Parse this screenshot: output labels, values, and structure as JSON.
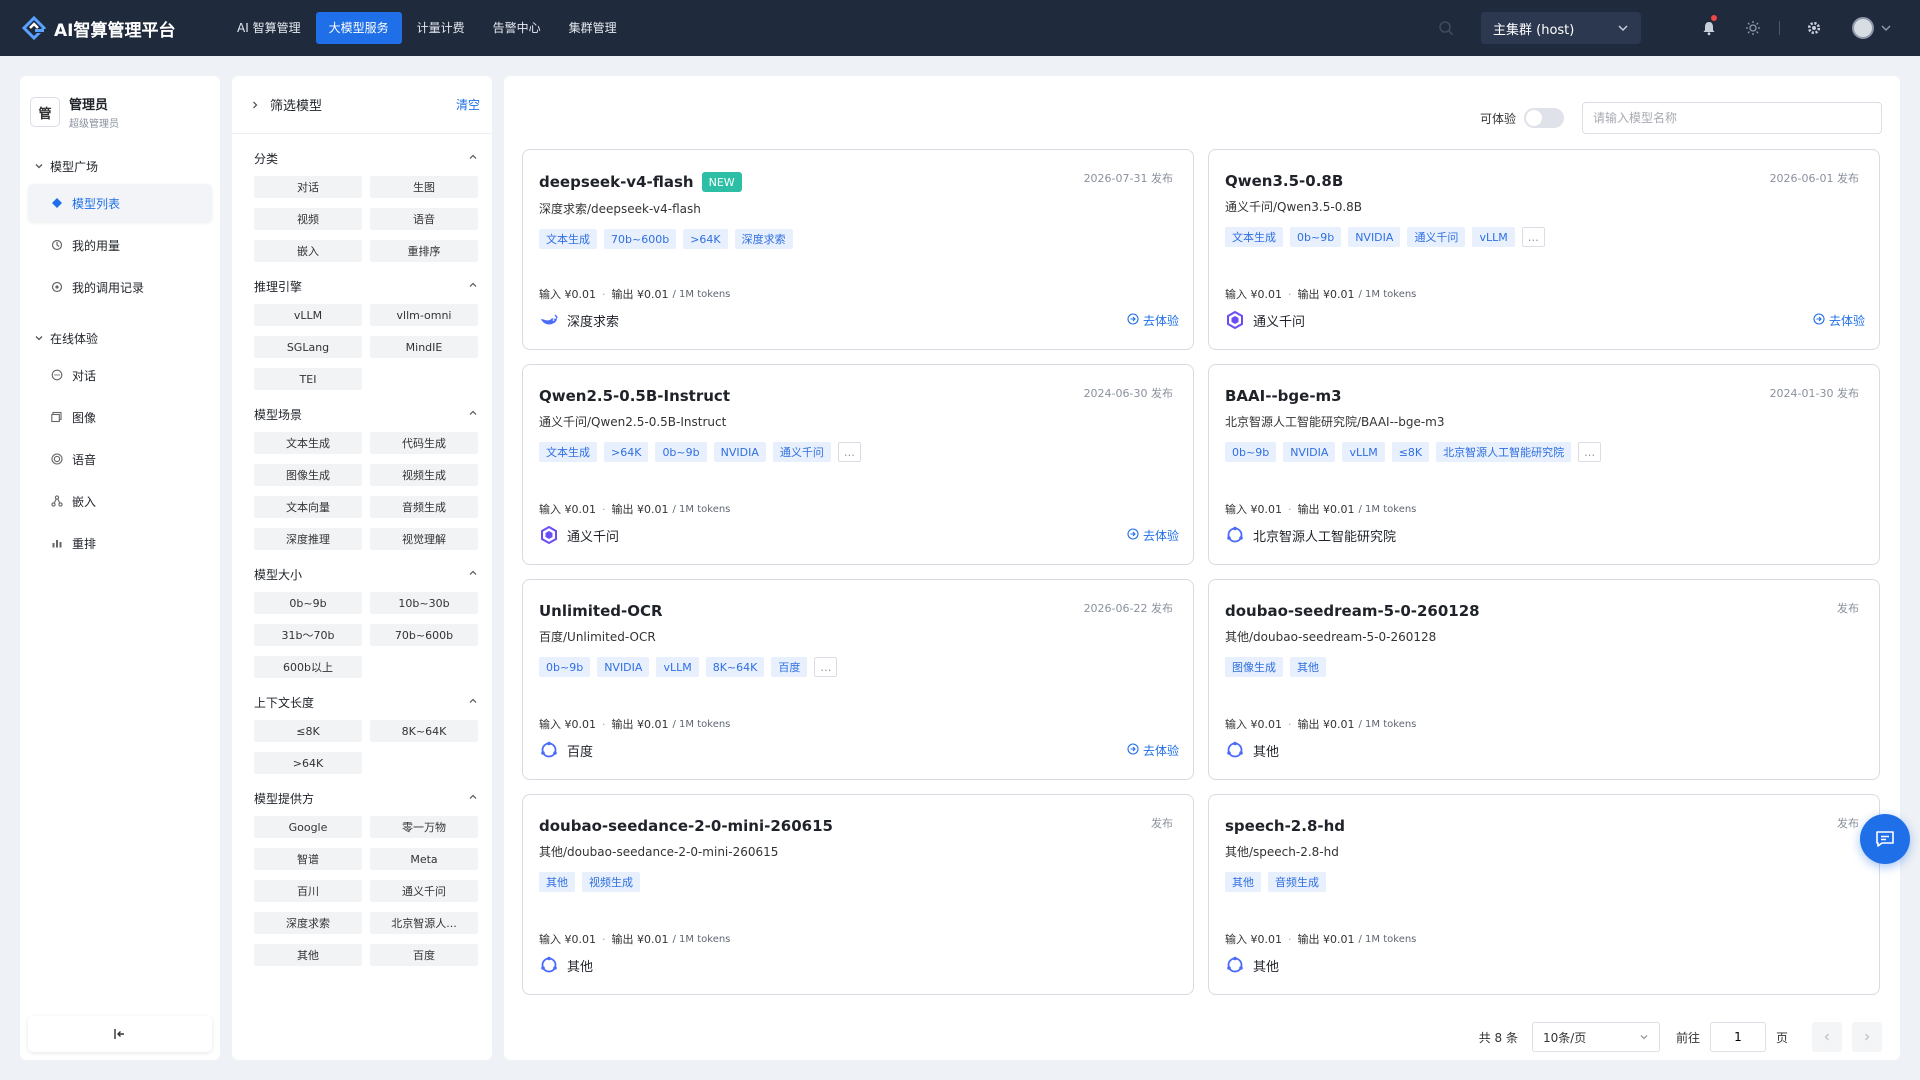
{
  "app": {
    "title": "AI智算管理平台"
  },
  "topnav": [
    {
      "label": "AI 智算管理",
      "active": false
    },
    {
      "label": "大模型服务",
      "active": true
    },
    {
      "label": "计量计费",
      "active": false
    },
    {
      "label": "告警中心",
      "active": false
    },
    {
      "label": "集群管理",
      "active": false
    }
  ],
  "cluster": {
    "selected": "主集群 (host)"
  },
  "user": {
    "badge": "管",
    "name": "管理员",
    "role": "超级管理员"
  },
  "sidebar": {
    "groups": [
      {
        "title": "模型广场",
        "items": [
          {
            "label": "模型列表",
            "icon": "diamond-icon",
            "active": true
          },
          {
            "label": "我的用量",
            "icon": "usage-icon",
            "active": false
          },
          {
            "label": "我的调用记录",
            "icon": "record-icon",
            "active": false
          }
        ]
      },
      {
        "title": "在线体验",
        "items": [
          {
            "label": "对话",
            "icon": "chat-icon",
            "active": false
          },
          {
            "label": "图像",
            "icon": "image-icon",
            "active": false
          },
          {
            "label": "语音",
            "icon": "voice-icon",
            "active": false
          },
          {
            "label": "嵌入",
            "icon": "embed-icon",
            "active": false
          },
          {
            "label": "重排",
            "icon": "rerank-icon",
            "active": false
          }
        ]
      }
    ]
  },
  "filter": {
    "title": "筛选模型",
    "clear": "清空",
    "sections": [
      {
        "title": "分类",
        "options": [
          "对话",
          "生图",
          "视频",
          "语音",
          "嵌入",
          "重排序"
        ]
      },
      {
        "title": "推理引擎",
        "options": [
          "vLLM",
          "vllm-omni",
          "SGLang",
          "MindIE",
          "TEI"
        ]
      },
      {
        "title": "模型场景",
        "options": [
          "文本生成",
          "代码生成",
          "图像生成",
          "视频生成",
          "文本向量",
          "音频生成",
          "深度推理",
          "视觉理解"
        ]
      },
      {
        "title": "模型大小",
        "options": [
          "0b~9b",
          "10b~30b",
          "31b～70b",
          "70b~600b",
          "600b以上"
        ]
      },
      {
        "title": "上下文长度",
        "options": [
          "≤8K",
          "8K~64K",
          ">64K"
        ]
      },
      {
        "title": "模型提供方",
        "options": [
          "Google",
          "零一万物",
          "智谱",
          "Meta",
          "百川",
          "通义千问",
          "深度求索",
          "北京智源人...",
          "其他",
          "百度"
        ]
      }
    ]
  },
  "toolbar": {
    "experience_label": "可体验",
    "search_placeholder": "请输入模型名称"
  },
  "price": {
    "input": "输入 ¥0.01",
    "dot": "·",
    "output": "输出 ¥0.01",
    "unit": "/ 1M tokens"
  },
  "try_label": "去体验",
  "cards": [
    {
      "name": "deepseek-v4-flash",
      "badge": "NEW",
      "date": "2026-07-31 发布",
      "path": "深度求索/deepseek-v4-flash",
      "tags": [
        "文本生成",
        "70b~600b",
        ">64K",
        "深度求索"
      ],
      "more": false,
      "provider": "深度求索",
      "provider_icon": "whale-icon",
      "try": true
    },
    {
      "name": "Qwen3.5-0.8B",
      "badge": "",
      "date": "2026-06-01 发布",
      "path": "通义千问/Qwen3.5-0.8B",
      "tags": [
        "文本生成",
        "0b~9b",
        "NVIDIA",
        "通义千问",
        "vLLM"
      ],
      "more": true,
      "provider": "通义千问",
      "provider_icon": "qwen-icon",
      "try": true
    },
    {
      "name": "Qwen2.5-0.5B-Instruct",
      "badge": "",
      "date": "2024-06-30 发布",
      "path": "通义千问/Qwen2.5-0.5B-Instruct",
      "tags": [
        "文本生成",
        ">64K",
        "0b~9b",
        "NVIDIA",
        "通义千问"
      ],
      "more": true,
      "provider": "通义千问",
      "provider_icon": "qwen-icon",
      "try": true
    },
    {
      "name": "BAAI--bge-m3",
      "badge": "",
      "date": "2024-01-30 发布",
      "path": "北京智源人工智能研究院/BAAI--bge-m3",
      "tags": [
        "0b~9b",
        "NVIDIA",
        "vLLM",
        "≤8K",
        "北京智源人工智能研究院"
      ],
      "more": true,
      "provider": "北京智源人工智能研究院",
      "provider_icon": "generic-provider-icon",
      "try": false
    },
    {
      "name": "Unlimited-OCR",
      "badge": "",
      "date": "2026-06-22 发布",
      "path": "百度/Unlimited-OCR",
      "tags": [
        "0b~9b",
        "NVIDIA",
        "vLLM",
        "8K~64K",
        "百度"
      ],
      "more": true,
      "provider": "百度",
      "provider_icon": "generic-provider-icon",
      "try": true
    },
    {
      "name": "doubao-seedream-5-0-260128",
      "badge": "",
      "date": "发布",
      "path": "其他/doubao-seedream-5-0-260128",
      "tags": [
        "图像生成",
        "其他"
      ],
      "more": false,
      "provider": "其他",
      "provider_icon": "generic-provider-icon",
      "try": false
    },
    {
      "name": "doubao-seedance-2-0-mini-260615",
      "badge": "",
      "date": "发布",
      "path": "其他/doubao-seedance-2-0-mini-260615",
      "tags": [
        "其他",
        "视频生成"
      ],
      "more": false,
      "provider": "其他",
      "provider_icon": "generic-provider-icon",
      "try": false
    },
    {
      "name": "speech-2.8-hd",
      "badge": "",
      "date": "发布",
      "path": "其他/speech-2.8-hd",
      "tags": [
        "其他",
        "音频生成"
      ],
      "more": false,
      "provider": "其他",
      "provider_icon": "generic-provider-icon",
      "try": false
    }
  ],
  "pager": {
    "total": "共 8 条",
    "page_size": "10条/页",
    "goto": "前往",
    "page": "1",
    "page_suffix": "页"
  },
  "colors": {
    "topbar": "#1f2a3c",
    "accent": "#1f6fe8",
    "new_badge": "#2dbfa6",
    "tag_bg": "#e8f0fe",
    "tag_text": "#2f6fe0"
  }
}
